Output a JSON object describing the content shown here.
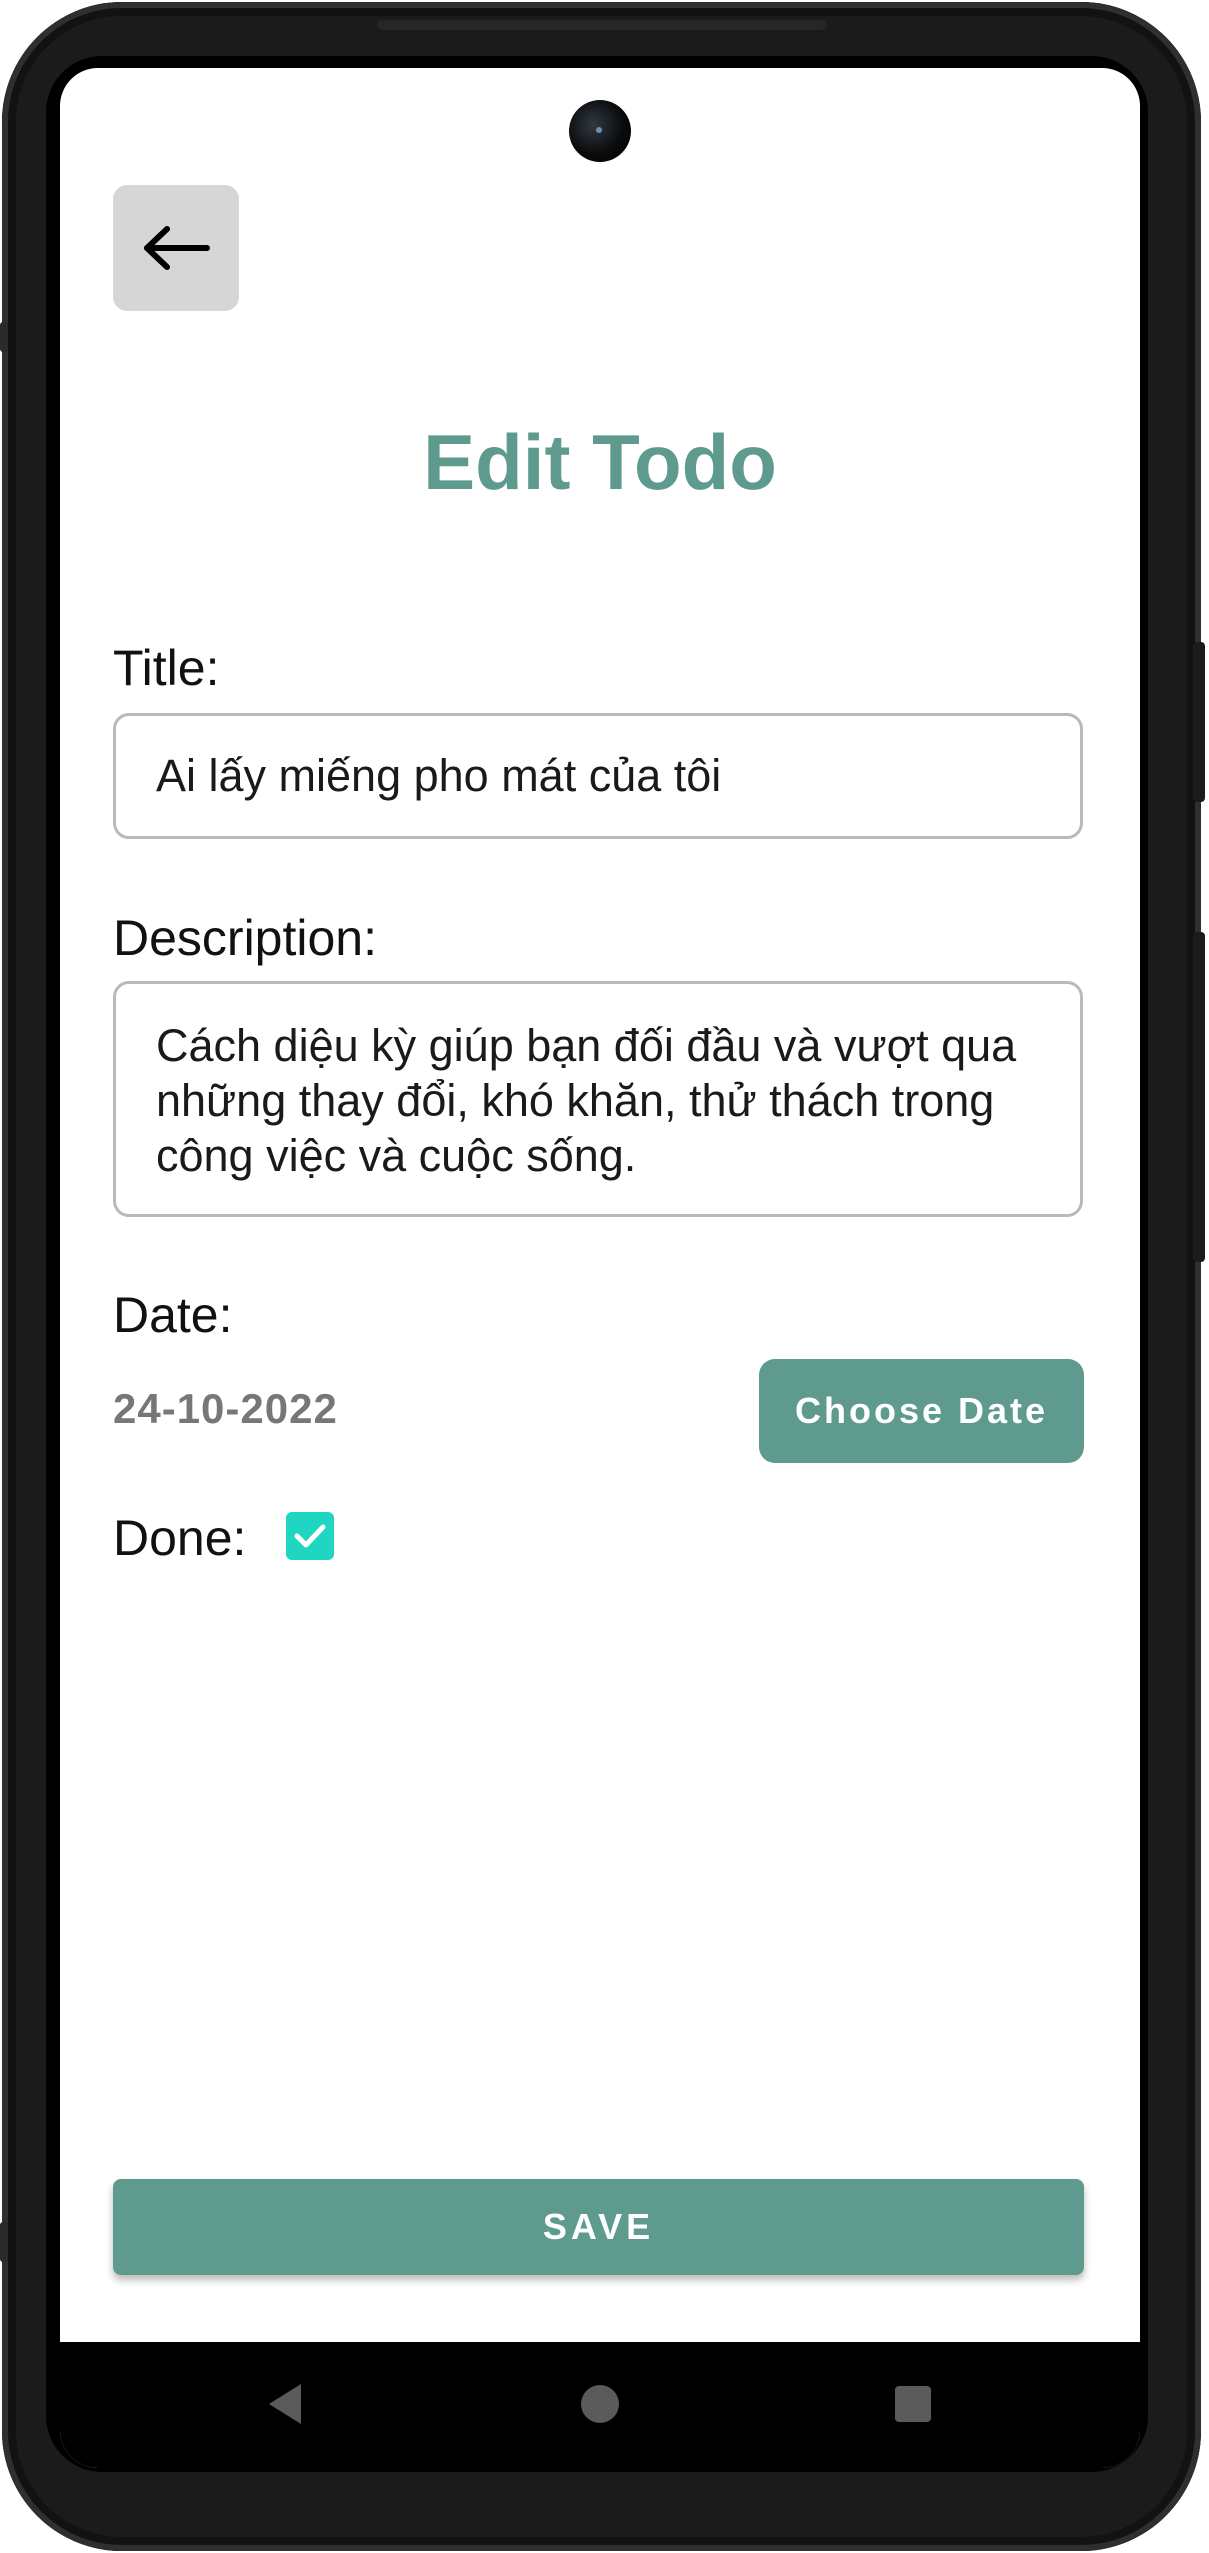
{
  "header": {
    "back_icon": "arrow-left-icon",
    "title": "Edit Todo"
  },
  "form": {
    "title_label": "Title:",
    "title_value": "Ai lấy miếng pho mát của tôi",
    "description_label": "Description:",
    "description_value": "Cách diệu kỳ giúp bạn đối đầu và vượt qua những thay đổi, khó khăn, thử thách trong công việc và cuộc sống.",
    "date_label": "Date:",
    "date_value": "24-10-2022",
    "choose_date_label": "Choose Date",
    "done_label": "Done:",
    "done_checked": true,
    "save_label": "SAVE"
  },
  "navigation_bar": {
    "buttons": [
      "back-triangle-icon",
      "home-circle-icon",
      "recents-square-icon"
    ]
  },
  "colors": {
    "accent": "#5f9a8f",
    "checkbox": "#1ed6c2",
    "back_button_bg": "#d6d6d6",
    "date_text": "#777777"
  }
}
